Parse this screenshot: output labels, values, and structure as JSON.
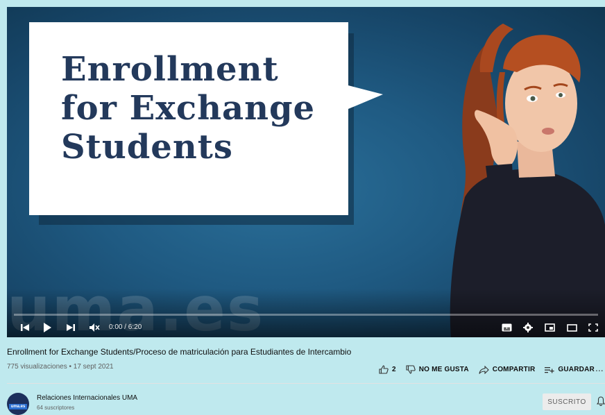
{
  "thumbnail": {
    "title": "Enrollment\nfor Exchange\nStudents",
    "watermark": "uma.es"
  },
  "player": {
    "time": "0:00 / 6:20",
    "progress_fraction": 0.0,
    "controls": [
      "previous-icon",
      "play-icon",
      "next-icon",
      "mute-icon",
      "subtitles-icon",
      "settings-icon",
      "miniplayer-icon",
      "theater-icon",
      "fullscreen-icon"
    ]
  },
  "video": {
    "title": "Enrollment for Exchange Students/Proceso de matriculación para Estudiantes de Intercambio",
    "meta": "775 visualizaciones • 17 sept 2021"
  },
  "actions": {
    "like_count": "2",
    "dislike_label": "NO ME GUSTA",
    "share_label": "COMPARTIR",
    "save_label": "GUARDAR",
    "more_label": "..."
  },
  "channel": {
    "name": "Relaciones Internacionales UMA",
    "subscribers": "64 suscriptores",
    "avatar_text": "uma.es",
    "subscribed_label": "SUSCRITO"
  },
  "colors": {
    "page_bg": "#bfe9ee",
    "progress_played": "#ff0000",
    "title_navy": "#23395b"
  }
}
